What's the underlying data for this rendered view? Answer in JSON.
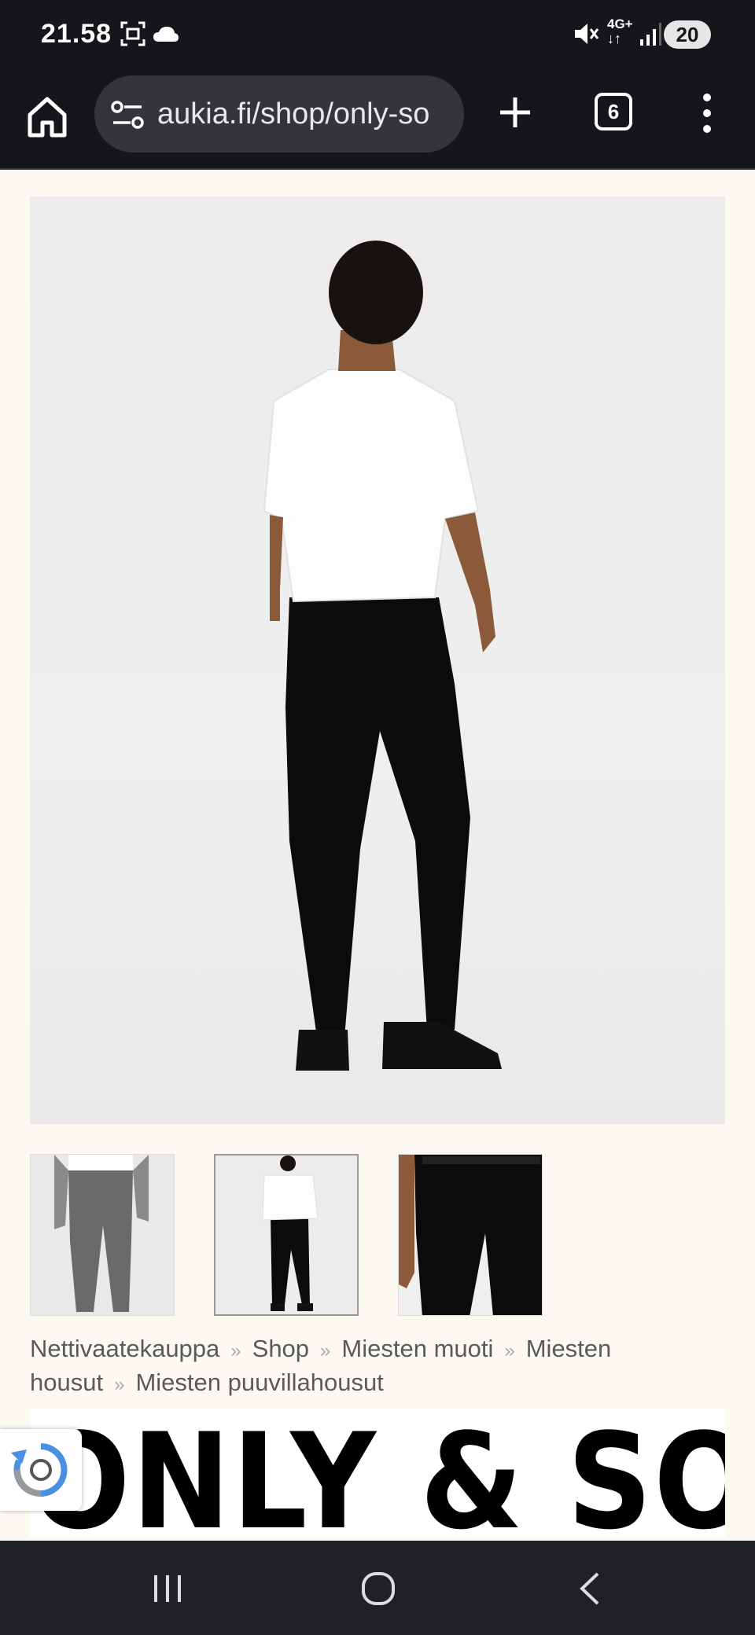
{
  "status_bar": {
    "time": "21.58",
    "battery": "20",
    "network": "4G+",
    "icons": [
      "screenshot-icon",
      "cloud-icon",
      "mute-icon",
      "network-4g-icon",
      "signal-icon",
      "battery-icon"
    ]
  },
  "browser": {
    "url": "aukia.fi/shop/only-so",
    "tab_count": "6",
    "icons": [
      "home-icon",
      "site-settings-icon",
      "new-tab-icon",
      "tabs-icon",
      "more-menu-icon"
    ]
  },
  "breadcrumb": {
    "items": [
      "Nettivaatekauppa",
      "Shop",
      "Miesten muoti",
      "Miesten housut",
      "Miesten puuvillahousut"
    ],
    "separator": "»"
  },
  "brand": {
    "logo_text": "ONLY & SONS"
  },
  "nav": {
    "icons": [
      "recent-apps-icon",
      "home-circle-icon",
      "back-icon"
    ]
  },
  "colors": {
    "page_bg": "#fbf9f2",
    "bar_bg": "#15161a",
    "nav_bg": "#202125"
  }
}
